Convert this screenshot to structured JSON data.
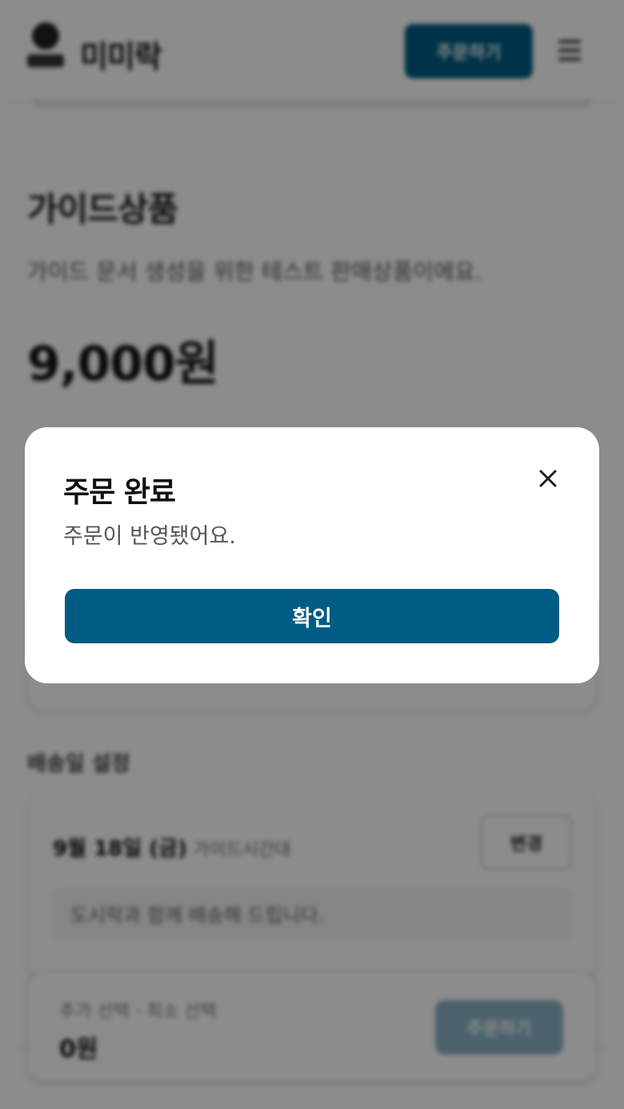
{
  "header": {
    "brand": "미미락",
    "order_button": "주문하기",
    "menu_icon": "hamburger-menu-icon"
  },
  "product": {
    "title": "가이드상품",
    "description": "가이드 문서 생성을 위한 테스트 판매상품이에요.",
    "price": "9,000원"
  },
  "schedule": {
    "section_label": "배송일 설정",
    "date": "9월 18일 (금)",
    "time": "가이드시간대",
    "change_button": "변경",
    "note": "도시락과 함께 배송해 드립니다."
  },
  "summary": {
    "label": "추가 선택 · 최소 선택",
    "total": "0원",
    "order_button": "주문하기"
  },
  "modal": {
    "title": "주문 완료",
    "message": "주문이 반영됐어요.",
    "confirm_button": "확인",
    "close_icon": "close-icon"
  },
  "colors": {
    "primary": "#005c84",
    "primary_disabled": "#89b2c6",
    "overlay": "rgba(0,0,0,0.45)"
  }
}
